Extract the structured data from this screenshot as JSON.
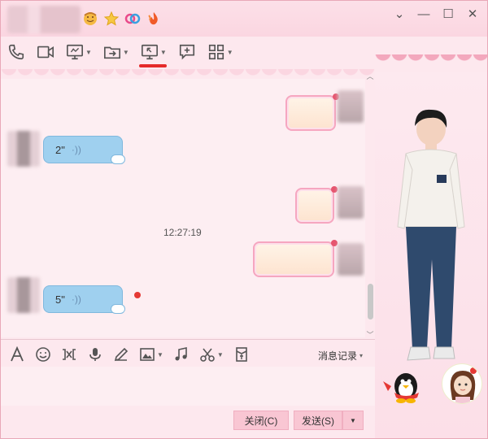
{
  "titlebar": {
    "badges": [
      "face-emoji",
      "star",
      "link",
      "flame"
    ],
    "controls": [
      "settings",
      "minimize",
      "maximize",
      "close"
    ]
  },
  "toolbar": {
    "items": [
      {
        "name": "phone-icon",
        "caret": false
      },
      {
        "name": "video-icon",
        "caret": false
      },
      {
        "name": "screen-share-icon",
        "caret": true
      },
      {
        "name": "file-transfer-icon",
        "caret": true
      },
      {
        "name": "remote-desktop-icon",
        "caret": true,
        "active": true
      },
      {
        "name": "new-chat-icon",
        "caret": false
      },
      {
        "name": "apps-grid-icon",
        "caret": true
      }
    ]
  },
  "messages": {
    "voice1": {
      "duration": "2\"",
      "wave": "·))"
    },
    "voice2": {
      "duration": "5\"",
      "wave": "·))"
    },
    "timestamp": "12:27:19"
  },
  "input_toolbar": {
    "history_label": "消息记录",
    "history_caret": "▾"
  },
  "buttons": {
    "close": "关闭(C)",
    "send": "发送(S)",
    "send_dropdown": "▼"
  },
  "colors": {
    "accent": "#e52a2a",
    "bubble_in": "#9fd0ef",
    "bubble_out_border": "#f6a6c0",
    "window_bg": "#fde8ee"
  }
}
